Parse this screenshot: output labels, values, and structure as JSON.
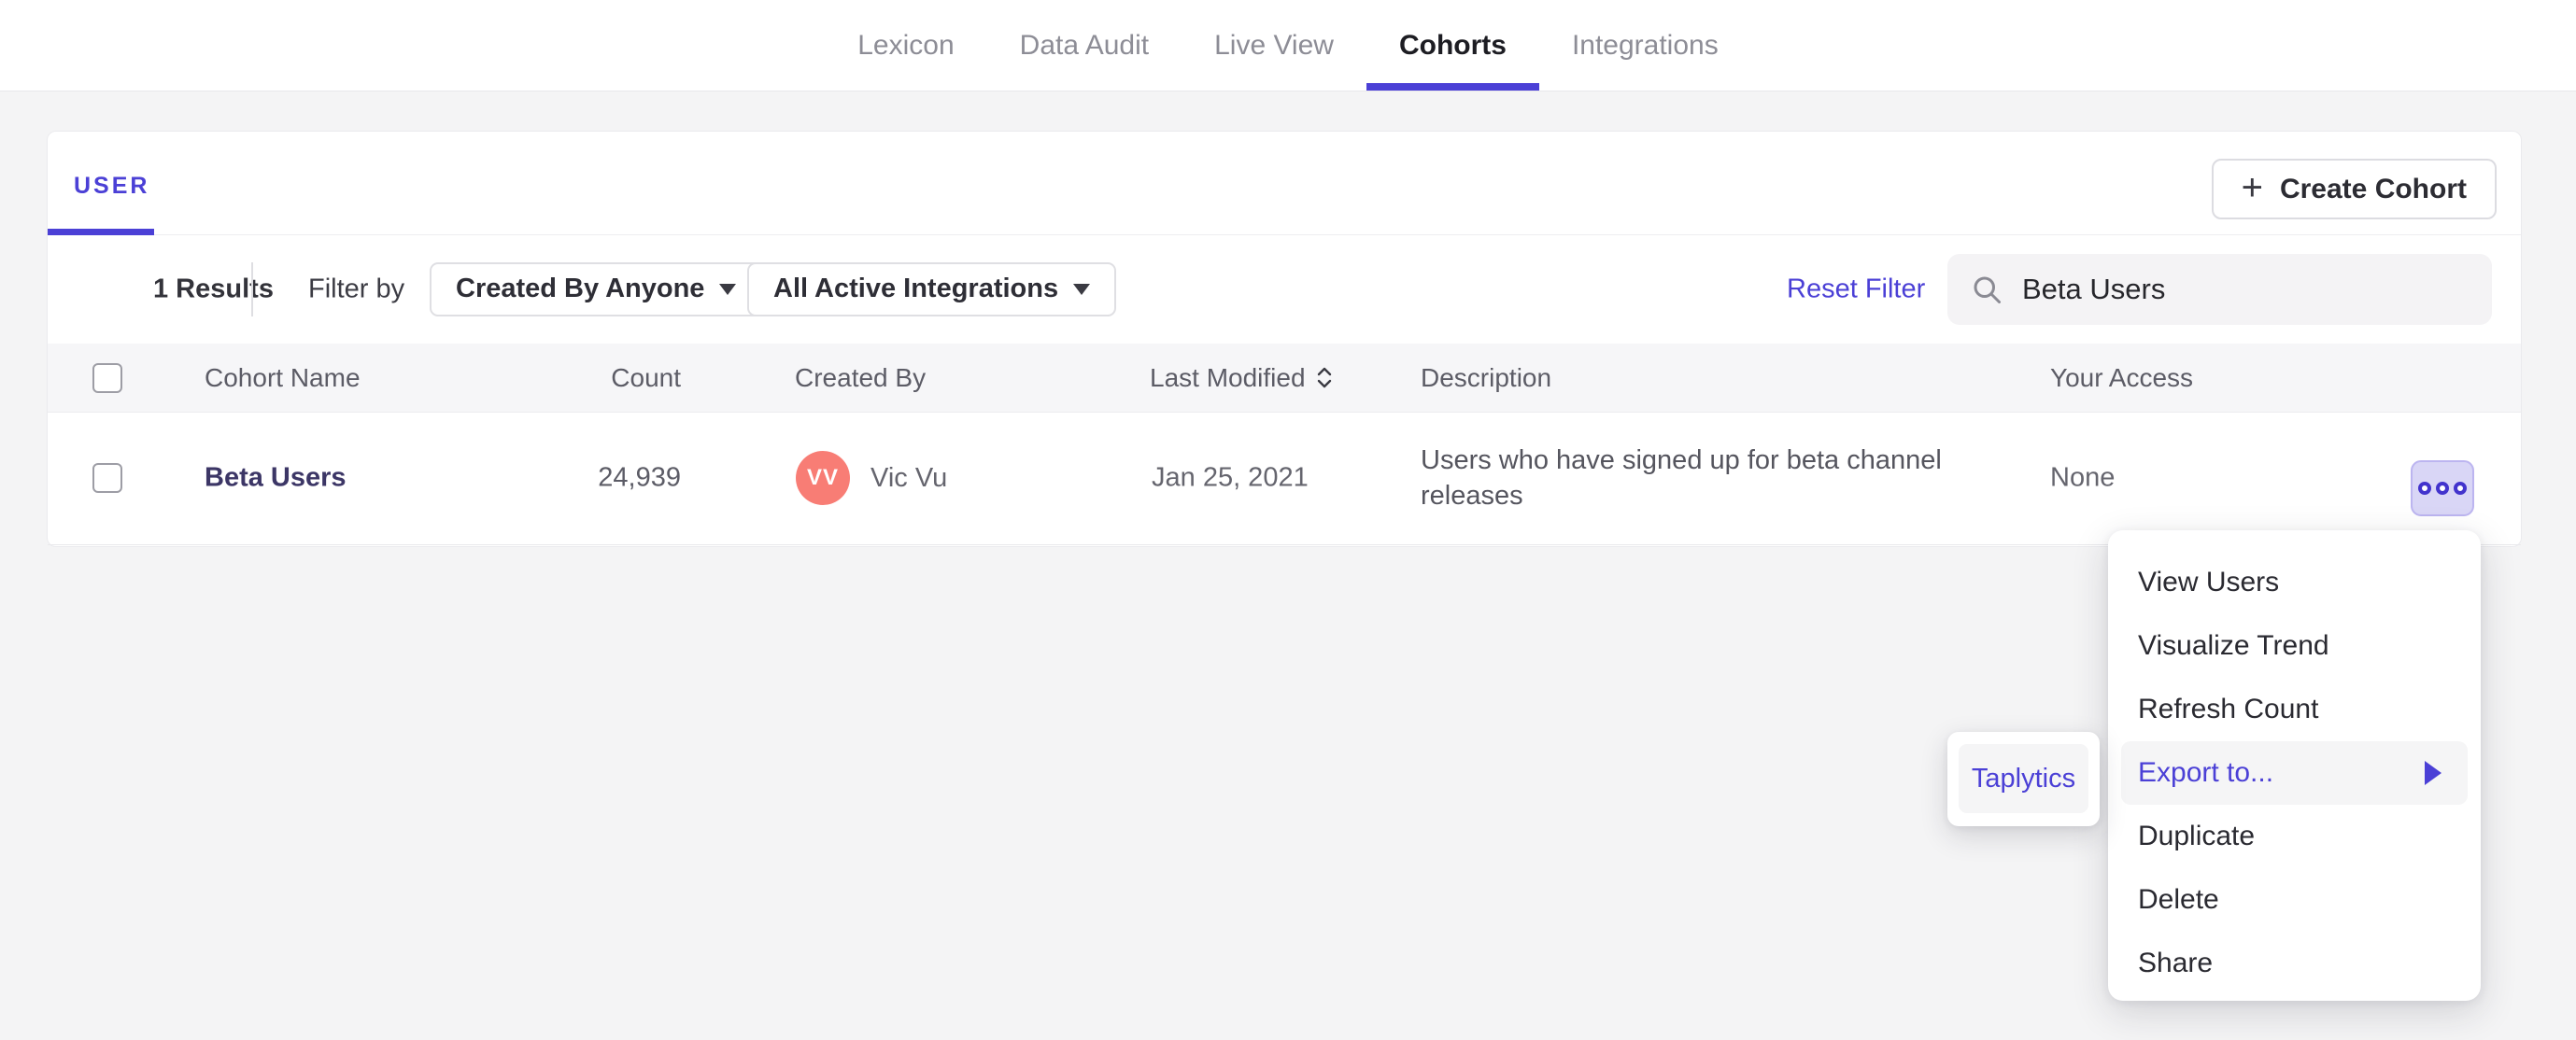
{
  "nav": {
    "tabs": [
      {
        "label": "Lexicon",
        "active": false
      },
      {
        "label": "Data Audit",
        "active": false
      },
      {
        "label": "Live View",
        "active": false
      },
      {
        "label": "Cohorts",
        "active": true
      },
      {
        "label": "Integrations",
        "active": false
      }
    ]
  },
  "panel": {
    "user_tab_label": "USER",
    "create_cohort": {
      "plus_glyph": "+",
      "label": "Create Cohort"
    },
    "filter_bar": {
      "results_text": "1 Results",
      "filter_by_label": "Filter by",
      "created_by_dropdown": "Created By Anyone",
      "integrations_dropdown": "All Active Integrations",
      "reset_filter_label": "Reset Filter",
      "search_value": "Beta Users"
    },
    "table": {
      "headers": {
        "name": "Cohort Name",
        "count": "Count",
        "created_by": "Created By",
        "last_modified": "Last Modified",
        "description": "Description",
        "access": "Your Access"
      },
      "row": {
        "name": "Beta Users",
        "count": "24,939",
        "avatar_initials": "VV",
        "created_by": "Vic Vu",
        "last_modified": "Jan 25, 2021",
        "description": "Users who have signed up for beta channel releases",
        "access": "None"
      }
    }
  },
  "context_menu": {
    "items": [
      "View Users",
      "Visualize Trend",
      "Refresh Count",
      "Export to...",
      "Duplicate",
      "Delete",
      "Share"
    ],
    "highlighted_item": "Export to...",
    "submenu_item": "Taplytics"
  },
  "colors": {
    "accent_purple": "#4b40d6",
    "cohort_link": "#3c3666",
    "avatar_bg": "#f87d75",
    "dots_button_bg": "#d9d6f6",
    "page_bg": "#f4f4f5",
    "menu_highlight_bg": "#f5f5f6"
  }
}
